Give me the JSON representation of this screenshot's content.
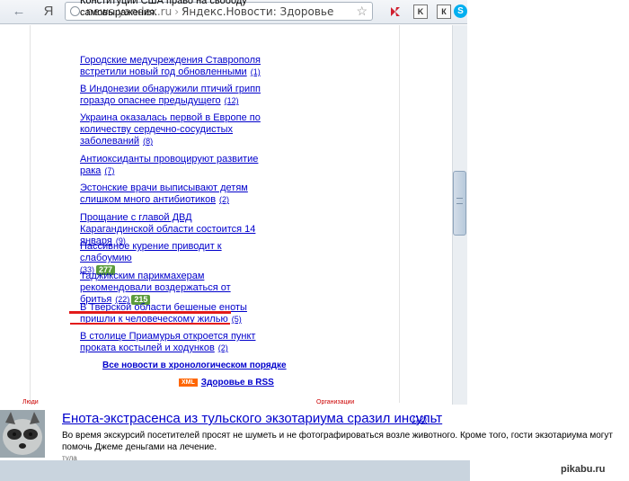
{
  "browser": {
    "back_icon": "back-arrow-icon",
    "back": "←",
    "yandex_logo": "Я",
    "url_domain": "news.yandex.ru",
    "url_sep": "›",
    "url_title": "Яндекс.Новости: Здоровье",
    "star": "☆",
    "ext_k2": "K",
    "ext_k3": "К",
    "ext_skype": "S"
  },
  "news_items": [
    {
      "text": "Конституции США право на свободу самовыражения.",
      "count": ""
    },
    {
      "text": "Городские медучреждения Ставрополя встретили новый год обновленными",
      "count": "(1)"
    },
    {
      "text": "В Индонезии обнаружили птичий грипп гораздо опаснее предыдущего",
      "count": "(12)"
    },
    {
      "text": "Украина оказалась первой в Европе по количеству сердечно-сосудистых заболеваний",
      "count": "(8)"
    },
    {
      "text": "Антиоксиданты провоцируют развитие рака",
      "count": "(7)"
    },
    {
      "text": "Эстонские врачи выписывают детям слишком много антибиотиков",
      "count": "(2)"
    },
    {
      "text": "Прощание с главой ДВД Карагандинской области состоится 14 января",
      "count": "(9)"
    },
    {
      "text": "Пассивное курение приводит к слабоумию",
      "count": "(33)",
      "badge": "277"
    },
    {
      "text": "Таджикским парикмахерам рекомендовали воздержаться от бритья",
      "count": "(22)",
      "badge": "215"
    },
    {
      "text": "В Тверской области бешеные еноты пришли к человеческому жилью",
      "count": "(5)"
    },
    {
      "text": "В столице Приамурья откроется пункт проката костылей и ходунков",
      "count": "(2)"
    }
  ],
  "all_news": "Все новости в хронологическом порядке",
  "rss": {
    "xml": "XML",
    "label": "Здоровье в RSS"
  },
  "cut_left": "Люди",
  "cut_right": "Организации",
  "article": {
    "title": "Енота-экстрасенса из тульского экзотариума сразил инсульт",
    "count": "(12)",
    "text": "Во время экскурсий посетителей просят не шуметь и не фотографироваться возле животного. Кроме того, гости экзотариума могут помочь Джеме деньгами на лечение.",
    "cut": "тула"
  },
  "watermark": "pikabu.ru",
  "colors": {
    "link": "#0000cc",
    "highlight": "#e21b1b",
    "badge": "#5a9b3c"
  }
}
